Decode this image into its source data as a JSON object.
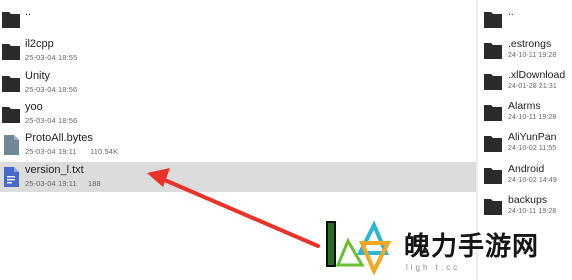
{
  "left_pane": {
    "items": [
      {
        "name": "..",
        "date": "",
        "size": "",
        "icon": "folder-icon",
        "selected": false
      },
      {
        "name": "il2cpp",
        "date": "25-03-04 18:55",
        "size": "",
        "icon": "folder-icon",
        "selected": false
      },
      {
        "name": "Unity",
        "date": "25-03-04 18:56",
        "size": "",
        "icon": "folder-icon",
        "selected": false
      },
      {
        "name": "yoo",
        "date": "25-03-04 18:56",
        "size": "",
        "icon": "folder-icon",
        "selected": false
      },
      {
        "name": "ProtoAll.bytes",
        "date": "25-03-04 19:11",
        "size": "110.54K",
        "icon": "file-icon",
        "selected": false
      },
      {
        "name": "version_l.txt",
        "date": "25-03-04 19:11",
        "size": "188",
        "icon": "text-file-icon",
        "selected": true
      }
    ]
  },
  "right_pane": {
    "items": [
      {
        "name": "..",
        "date": ""
      },
      {
        "name": ".estrongs",
        "date": "24-10-11 19:28"
      },
      {
        "name": ".xlDownload",
        "date": "24-01-28 21:31"
      },
      {
        "name": "Alarms",
        "date": "24-10-11 19:28"
      },
      {
        "name": "AliYunPan",
        "date": "24-10-02 11:55"
      },
      {
        "name": "Android",
        "date": "24-10-02 14:49"
      },
      {
        "name": "backups",
        "date": "24-10-11 19:28"
      }
    ]
  },
  "watermark": {
    "title": "魄力手游网",
    "subtitle": "ligh t.cc"
  },
  "colors": {
    "folder": "#2b2b2b",
    "file": "#6f8797",
    "text_file": "#4668c6",
    "selected_row": "#dcdcdc",
    "arrow": "#e8332a"
  }
}
